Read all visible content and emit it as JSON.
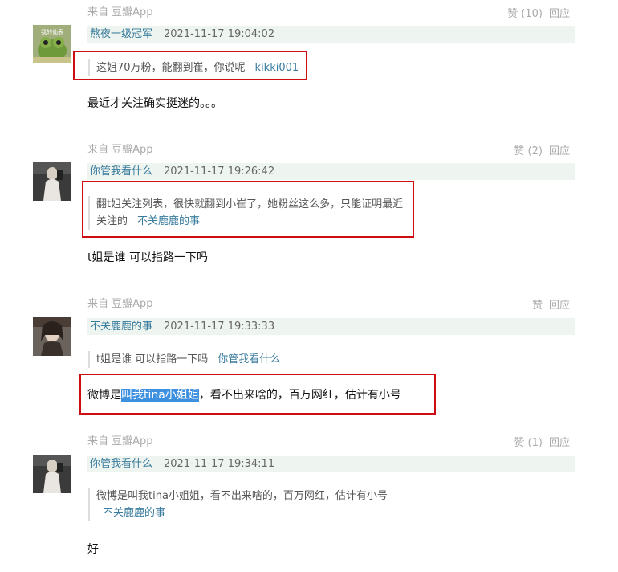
{
  "comments": [
    {
      "source": "来自 豆瓣App",
      "likes": "赞 (10)",
      "reply": "回应",
      "username": "熬夜一级冠军",
      "time": "2021-11-17 19:04:02",
      "quote_text": "这姐70万粉，能翻到崔，你说呢",
      "quote_author": "kikki001",
      "text": "最近才关注确实挺迷的。。。"
    },
    {
      "source": "来自 豆瓣App",
      "likes": "赞 (2)",
      "reply": "回应",
      "username": "你管我看什么",
      "time": "2021-11-17 19:26:42",
      "quote_line1": "翻t姐关注列表，很快就翻到小崔了，她粉丝这么多，只能证明最近",
      "quote_line2": "关注的",
      "quote_author": "不关鹿鹿的事",
      "text": "t姐是谁 可以指路一下吗"
    },
    {
      "source": "来自 豆瓣App",
      "likes": "赞",
      "reply": "回应",
      "username": "不关鹿鹿的事",
      "time": "2021-11-17 19:33:33",
      "quote_text": "t姐是谁 可以指路一下吗",
      "quote_author": "你管我看什么",
      "text_pre": "微博是",
      "text_highlight": "叫我tina小姐姐",
      "text_post": "，看不出来啥的，百万网红，估计有小号"
    },
    {
      "source": "来自 豆瓣App",
      "likes": "赞 (1)",
      "reply": "回应",
      "username": "你管我看什么",
      "time": "2021-11-17 19:34:11",
      "quote_text": "微博是叫我tina小姐姐，看不出来啥的，百万网红，估计有小号",
      "quote_author": "不关鹿鹿的事",
      "text": "好"
    }
  ],
  "avatar_text": "我的仙表",
  "colors": {
    "link": "#3a7c9e",
    "meta_bg": "#eef4ef",
    "annotation": "#cc0d12",
    "selection": "#3d8fe0"
  }
}
